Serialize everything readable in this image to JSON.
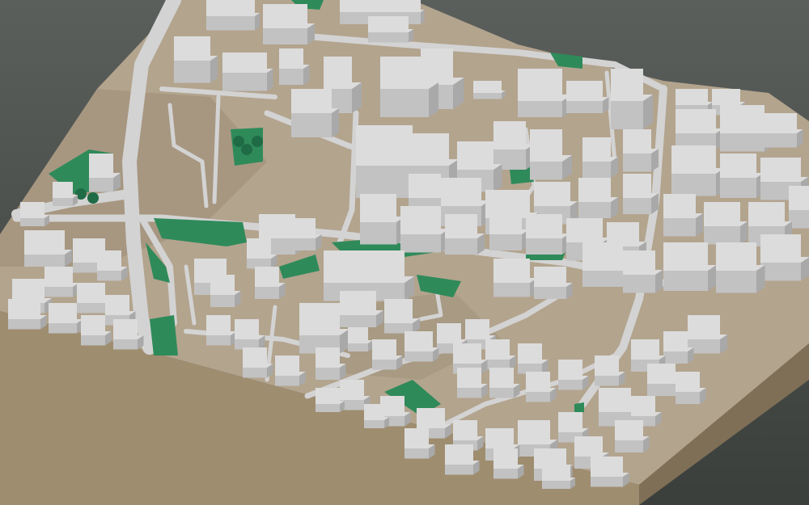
{
  "scene": {
    "background_top": "#5b5f5c",
    "background_bottom": "#3b3f3c",
    "terrain_color": "#b3a48e",
    "terrain_shade": "#9e8f78",
    "base_side_front": "#9f8d70",
    "base_side_dark": "#7f6f56",
    "road_color": "#d3d3d3",
    "building_top": "#dcdcdc",
    "building_left": "#c2c2c2",
    "building_right": "#a9a9a9",
    "park_color": "#2f8a5a",
    "tree_color": "#1f6b45"
  }
}
